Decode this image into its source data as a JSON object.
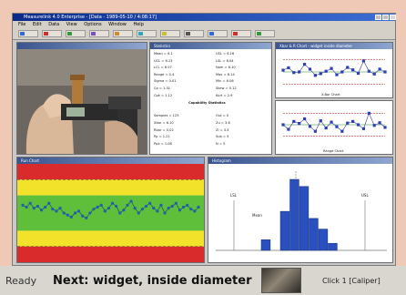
{
  "window": {
    "title": "Measurelink 4.0 Enterprise - [Data - 1989-05-10 / 4:08:17]"
  },
  "menu": [
    "File",
    "Edit",
    "Data",
    "View",
    "Options",
    "Window",
    "Help"
  ],
  "toolbar": [
    {
      "icon": "doc-icon",
      "color": "#2f6bd1"
    },
    {
      "icon": "chart-icon",
      "color": "#d12f2f"
    },
    {
      "icon": "save-icon",
      "color": "#2f9b3a"
    },
    {
      "icon": "print-icon",
      "color": "#7a4fc0"
    },
    {
      "icon": "graph-icon",
      "color": "#d18a2f"
    },
    {
      "icon": "stats-icon",
      "color": "#2fa5b8"
    },
    {
      "icon": "gauge-icon",
      "color": "#c9c02f"
    },
    {
      "icon": "camera-icon",
      "color": "#555555"
    },
    {
      "icon": "info-icon",
      "color": "#2f6bd1"
    },
    {
      "icon": "help-icon",
      "color": "#d12f2f"
    },
    {
      "icon": "exit-icon",
      "color": "#2f9b3a"
    }
  ],
  "stats_pane": {
    "title": "Statistics",
    "left_col": [
      "Mean = 6.1",
      "UCL = 6.13",
      "LCL = 6.07",
      "Range = 0.4",
      "Sigma = 0.01",
      "Cp = 1.31",
      "Cpk = 1.12",
      "",
      "",
      "Samples = 125",
      "Xbar = 6.10",
      "Rbar = 0.02",
      "Pp = 1.21",
      "Ppk = 1.08"
    ],
    "right_col": [
      "USL = 6.16",
      "LSL = 6.04",
      "Nom = 6.10",
      "Max = 6.14",
      "Min = 6.06",
      "Skew = 0.12",
      "Kurt = 2.9",
      "",
      "",
      "Out = 0",
      "Zu = 3.6",
      "Zl = 3.3",
      "Sub = 5",
      "N = 5"
    ],
    "section_label": "Capability Statistics"
  },
  "xbar_chart": {
    "title": "Xbar & R Chart - widget inside diameter",
    "label": "X-Bar Chart"
  },
  "range_chart": {
    "label": "Range Chart"
  },
  "run_chart": {
    "title": "Run Chart"
  },
  "histogram": {
    "title": "Histogram",
    "lsl_label": "LSL",
    "usl_label": "USL",
    "mean_label": "Mean"
  },
  "chart_data": [
    {
      "type": "line",
      "title": "X-Bar Chart",
      "x": [
        1,
        2,
        3,
        4,
        5,
        6,
        7,
        8,
        9,
        10,
        11,
        12,
        13,
        14,
        15,
        16,
        17,
        18,
        19,
        20
      ],
      "values": [
        0.55,
        0.62,
        0.48,
        0.5,
        0.72,
        0.58,
        0.4,
        0.45,
        0.52,
        0.6,
        0.42,
        0.5,
        0.63,
        0.56,
        0.46,
        0.82,
        0.52,
        0.44,
        0.58,
        0.5
      ],
      "ylim": [
        0,
        1
      ]
    },
    {
      "type": "line",
      "title": "Range Chart",
      "x": [
        1,
        2,
        3,
        4,
        5,
        6,
        7,
        8,
        9,
        10,
        11,
        12,
        13,
        14,
        15,
        16,
        17,
        18,
        19,
        20
      ],
      "values": [
        0.5,
        0.36,
        0.6,
        0.54,
        0.68,
        0.45,
        0.3,
        0.62,
        0.4,
        0.58,
        0.44,
        0.3,
        0.55,
        0.6,
        0.5,
        0.38,
        0.85,
        0.48,
        0.56,
        0.42
      ],
      "ylim": [
        0,
        1
      ]
    },
    {
      "type": "scatter",
      "title": "Run Chart",
      "x": [
        1,
        2,
        3,
        4,
        5,
        6,
        7,
        8,
        9,
        10,
        11,
        12,
        13,
        14,
        15,
        16,
        17,
        18,
        19,
        20,
        21,
        22,
        23,
        24,
        25,
        26,
        27,
        28,
        29,
        30,
        31,
        32,
        33,
        34,
        35,
        36,
        37,
        38,
        39,
        40,
        41,
        42,
        43,
        44,
        45,
        46,
        47,
        48
      ],
      "values": [
        0.58,
        0.56,
        0.6,
        0.55,
        0.57,
        0.53,
        0.56,
        0.6,
        0.54,
        0.52,
        0.55,
        0.5,
        0.48,
        0.46,
        0.5,
        0.52,
        0.47,
        0.45,
        0.5,
        0.54,
        0.56,
        0.58,
        0.52,
        0.55,
        0.6,
        0.57,
        0.5,
        0.53,
        0.58,
        0.62,
        0.55,
        0.5,
        0.54,
        0.57,
        0.6,
        0.55,
        0.52,
        0.58,
        0.5,
        0.55,
        0.57,
        0.6,
        0.53,
        0.56,
        0.58,
        0.54,
        0.52,
        0.56
      ],
      "ylim": [
        0,
        1
      ],
      "bands": [
        "#d92b2b",
        "#f2e22a",
        "#5fbf3a",
        "#f2e22a",
        "#d92b2b"
      ]
    },
    {
      "type": "bar",
      "title": "Histogram",
      "categories": [
        "1",
        "2",
        "3",
        "4",
        "5",
        "6",
        "7",
        "8"
      ],
      "values": [
        0.15,
        0,
        0.55,
        1.0,
        0.9,
        0.45,
        0.3,
        0.1
      ],
      "ylim": [
        0,
        1
      ]
    }
  ],
  "status": {
    "ready": "Ready",
    "next": "Next: widget, inside diameter",
    "click": "Click 1 [Caliper]"
  }
}
